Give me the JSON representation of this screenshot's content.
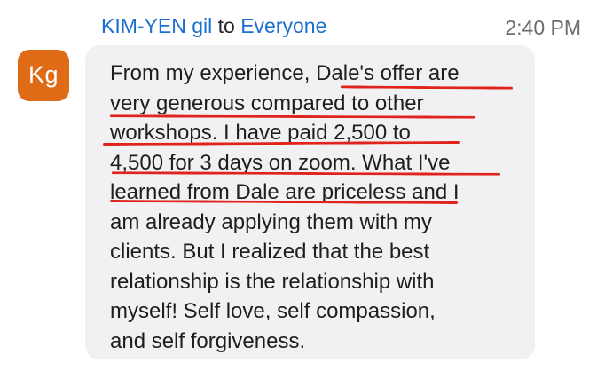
{
  "message": {
    "sender": "KIM-YEN gil",
    "connector": "to",
    "recipient": "Everyone",
    "time": "2:40 PM",
    "avatar_initials": "Kg",
    "lines": [
      "From my experience, Dale's offer are",
      "very generous compared to other",
      "workshops. I have paid 2,500 to",
      "4,500 for 3 days on zoom. What I've",
      "learned from Dale are priceless and I",
      "am already applying them with my",
      "clients. But I realized that the best",
      "relationship is the relationship with",
      "myself! Self love, self compassion,",
      "and self forgiveness."
    ]
  },
  "colors": {
    "sender": "#1b6fd1",
    "avatar": "#df6b17",
    "bubble": "#f1f1f3",
    "annotation": "#e0241d"
  }
}
